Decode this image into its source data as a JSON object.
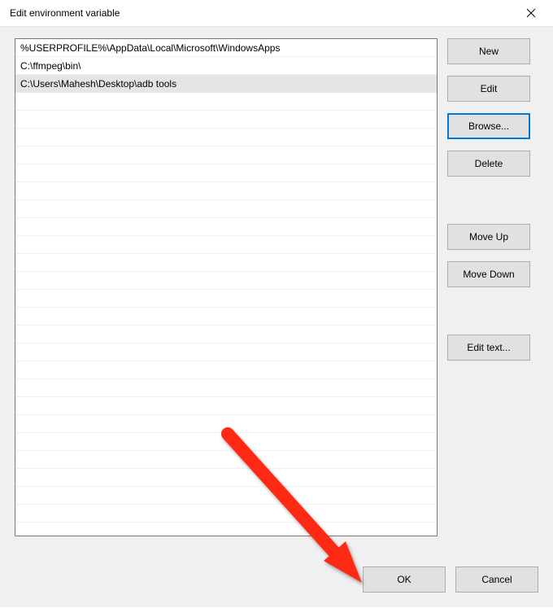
{
  "titlebar": {
    "title": "Edit environment variable"
  },
  "paths": [
    "%USERPROFILE%\\AppData\\Local\\Microsoft\\WindowsApps",
    "C:\\ffmpeg\\bin\\",
    "C:\\Users\\Mahesh\\Desktop\\adb tools"
  ],
  "selected_index": 2,
  "buttons": {
    "new": "New",
    "edit": "Edit",
    "browse": "Browse...",
    "delete": "Delete",
    "moveUp": "Move Up",
    "moveDown": "Move Down",
    "editText": "Edit text...",
    "ok": "OK",
    "cancel": "Cancel"
  },
  "listbox_total_rows": 27
}
